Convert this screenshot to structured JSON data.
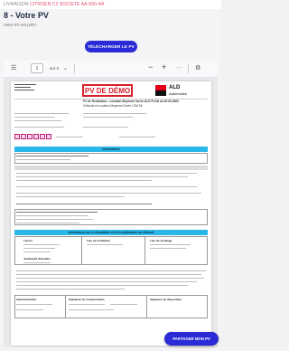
{
  "header": {
    "livraison_prefix": "LIVRAISON",
    "vehicle": "CITROEN C3 SOCIETE AA-000-AA",
    "title": "8 - Votre PV",
    "subtitle": "Votre PV est prêt !"
  },
  "actions": {
    "download_label": "TÉLÉCHARGER LE PV",
    "share_label": "PARTAGER MON PV"
  },
  "viewer": {
    "page_number": "1",
    "page_total": "sur 3",
    "menu_icon": "hamburger-icon",
    "zoom_in_icon": "plus-icon",
    "zoom_out_icon": "minus-icon",
    "more_icon": "ellipsis-icon",
    "settings_icon": "gear-icon",
    "search_icon": "search-icon",
    "toggle_icon": "chevron-icon"
  },
  "document": {
    "stamp": "PV DE DÉMO",
    "brand": "ALD",
    "brand_sub": "Automotive",
    "pv_title": "PV de Restitution - Location Moyenne Durée ALD PLAN du 00-00-0000",
    "pv_sub": "Véhicule en Location Moyenne Durée 1234 56",
    "info_section": "Informations",
    "vehicle_section": "Informations sur le dépositaire et la réceptionnaire du véhicule",
    "col1": "Livreur",
    "col2": "Lieu de restitution",
    "col3": "Lieu de stockage",
    "justif_label": "Justificatif d'identité :",
    "sig1": "Signature du réceptionnaire",
    "sig2": "Signature du dépositaire",
    "sig3": "Signature du conducteur",
    "plate_mini": "Immatriculation"
  },
  "colors": {
    "primary_button": "#2a2ad6",
    "band": "#28b7e8",
    "stamp": "#d9202a"
  }
}
